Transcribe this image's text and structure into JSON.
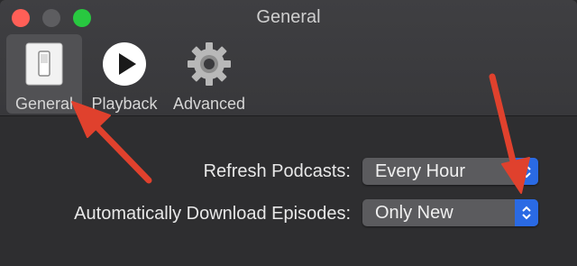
{
  "window": {
    "title": "General"
  },
  "toolbar": {
    "tabs": [
      {
        "label": "General",
        "icon": "switch-icon",
        "selected": true
      },
      {
        "label": "Playback",
        "icon": "play-icon",
        "selected": false
      },
      {
        "label": "Advanced",
        "icon": "gear-icon",
        "selected": false
      }
    ]
  },
  "settings": {
    "refresh": {
      "label": "Refresh Podcasts:",
      "value": "Every Hour"
    },
    "download": {
      "label": "Automatically Download Episodes:",
      "value": "Only New"
    }
  },
  "colors": {
    "annotation_arrow": "#e0412d",
    "stepper_accent": "#2a6ae4"
  }
}
